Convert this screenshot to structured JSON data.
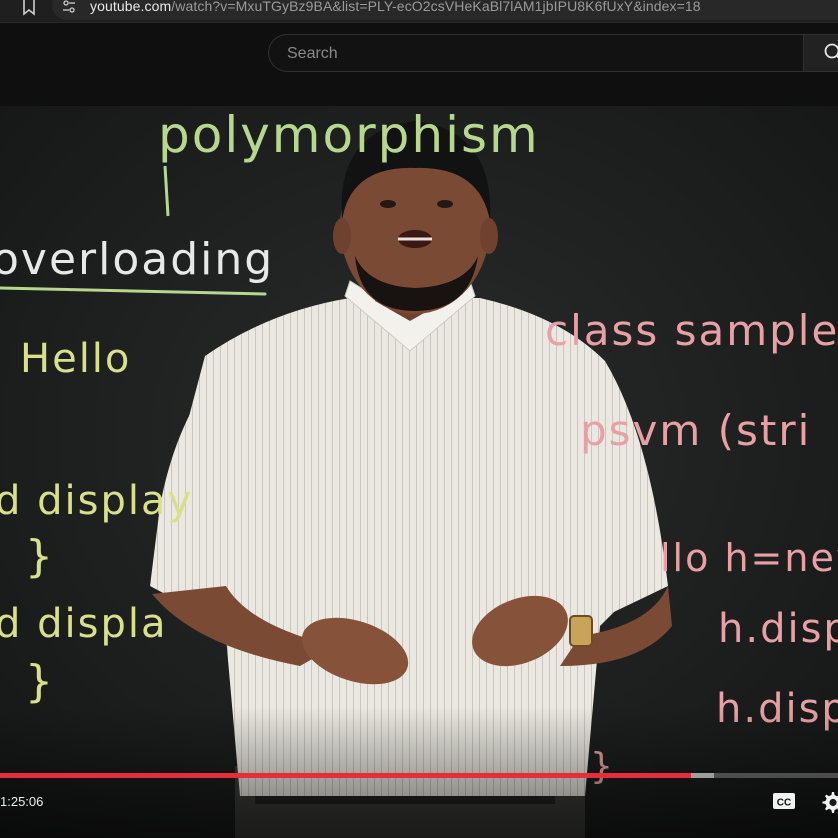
{
  "browser": {
    "url_host": "youtube.com",
    "url_rest": "/watch?v=MxuTGyBz9BA&list=PLY-ecO2csVHeKaBl7lAM1jbIPU8K6fUxY&index=18"
  },
  "header": {
    "search_placeholder": "Search"
  },
  "player": {
    "board": {
      "title": "polymorphism",
      "overloading": "overloading",
      "hello": "Hello",
      "display_1": "d display",
      "display_2": "d displa",
      "brace": "}",
      "class_sample": "class sample",
      "psvm": "psvm (stri",
      "new_hello": "llo  h=new",
      "h_display_1": "h.disp",
      "h_display_2": "h.displ"
    },
    "time": "1:25:06",
    "progress_played": 0.825,
    "progress_buffered": 0.852,
    "colors": {
      "progress": "#e62e3a",
      "board": "#1a1c1c",
      "shirt": "#ebe8e1"
    }
  }
}
